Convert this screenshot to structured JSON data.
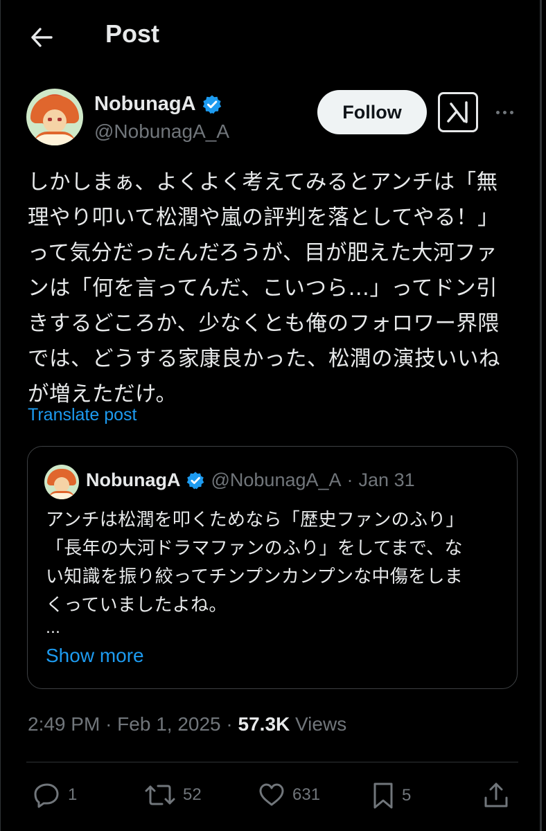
{
  "header": {
    "title": "Post",
    "back_icon": "arrow-left-icon"
  },
  "author": {
    "name": "NobunagA",
    "handle": "@NobunagA_A",
    "verified": true,
    "verified_color": "#1d9bf0"
  },
  "actions_top": {
    "follow_label": "Follow",
    "grok_icon": "grok-icon",
    "more_icon": "more-horizontal-icon"
  },
  "post": {
    "text": "しかしまぁ、よくよく考えてみるとアンチは「無\n理やり叩いて松潤や嵐の評判を落としてやる！」\nって気分だったんだろうが、目が肥えた大河ファ\nンは「何を言ってんだ、こいつら…」ってドン引\nきするどころか、少なくとも俺のフォロワー界隈\nでは、どうする家康良かった、松潤の演技いいね\nが増えただけ。",
    "translate_label": "Translate post",
    "time": "2:49 PM",
    "date": "Feb 1, 2025",
    "views_count": "57.3K",
    "views_label": "Views"
  },
  "quote": {
    "name": "NobunagA",
    "handle": "@NobunagA_A",
    "date": "Jan 31",
    "text": "アンチは松潤を叩くためなら「歴史ファンのふり」\n「長年の大河ドラマファンのふり」をしてまで、な\nい知識を振り絞ってチンプンカンプンな中傷をしま\nくっていましたよね。",
    "ellipsis": "...",
    "show_more_label": "Show more"
  },
  "engagement": {
    "replies": "1",
    "reposts": "52",
    "likes": "631",
    "bookmarks": "5"
  },
  "colors": {
    "background": "#000000",
    "text": "#e7e9ea",
    "muted": "#71767b",
    "accent": "#1d9bf0"
  }
}
